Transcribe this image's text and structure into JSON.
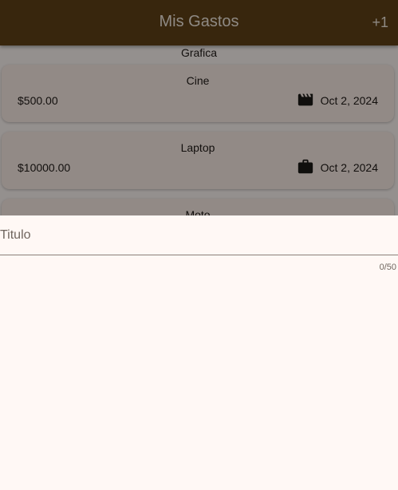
{
  "app_bar": {
    "title": "Mis Gastos",
    "action_label": "+1"
  },
  "list": {
    "section_label": "Grafica",
    "expenses": [
      {
        "title": "Cine",
        "amount": "$500.00",
        "date": "Oct 2, 2024",
        "icon": "movie-icon"
      },
      {
        "title": "Laptop",
        "amount": "$10000.00",
        "date": "Oct 2, 2024",
        "icon": "work-icon"
      },
      {
        "title": "Moto"
      }
    ]
  },
  "sheet": {
    "title_field": {
      "value": "",
      "placeholder": "Titulo",
      "counter": "0/50"
    }
  },
  "colors": {
    "app_bar": "#38260d",
    "surface": "#fff8f5",
    "card": "#fbeee7",
    "text": "#201a17"
  }
}
